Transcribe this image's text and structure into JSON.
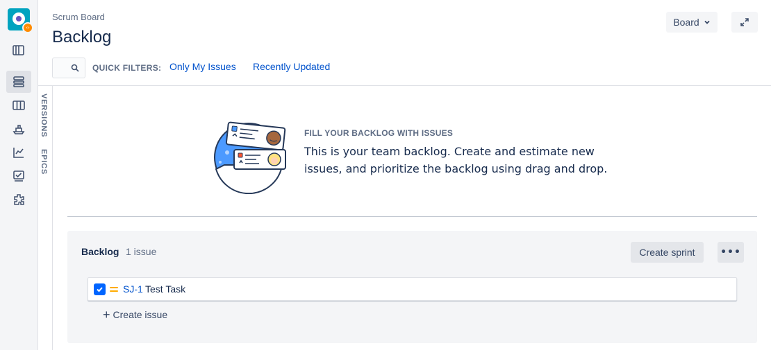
{
  "rail": {
    "items": [
      {
        "name": "roadmap-icon",
        "active": false
      },
      {
        "name": "backlog-icon",
        "active": true
      },
      {
        "name": "board-icon",
        "active": false
      },
      {
        "name": "releases-icon",
        "active": false
      },
      {
        "name": "reports-icon",
        "active": false
      },
      {
        "name": "issues-icon",
        "active": false
      },
      {
        "name": "addons-icon",
        "active": false
      }
    ]
  },
  "header": {
    "breadcrumb": "Scrum Board",
    "title": "Backlog",
    "board_button": "Board"
  },
  "filters": {
    "label": "QUICK FILTERS:",
    "items": [
      "Only My Issues",
      "Recently Updated"
    ]
  },
  "side_tabs": {
    "versions": "VERSIONS",
    "epics": "EPICS"
  },
  "empty_state": {
    "heading": "FILL YOUR BACKLOG WITH ISSUES",
    "body": "This is your team backlog. Create and estimate new issues, and prioritize the backlog using drag and drop."
  },
  "backlog": {
    "title": "Backlog",
    "count": "1 issue",
    "create_sprint": "Create sprint",
    "more": "•••",
    "issues": [
      {
        "key": "SJ-1",
        "summary": "Test Task",
        "type": "task",
        "priority": "medium"
      }
    ],
    "create_issue": "Create issue"
  },
  "colors": {
    "accent": "#0052cc",
    "task": "#0065ff",
    "priority_medium": "#ffab00",
    "logo": "#00a3bf"
  }
}
